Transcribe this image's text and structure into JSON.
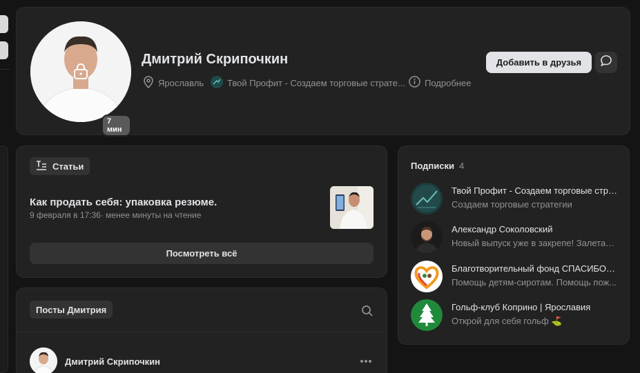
{
  "profile": {
    "name": "Дмитрий Скрипочкин",
    "online_badge": "7 мин",
    "city": "Ярославль",
    "work": "Твой Профит - Создаем торговые страте...",
    "more": "Подробнее",
    "add_friend": "Добавить в друзья"
  },
  "articles": {
    "chip": "Статьи",
    "title": "Как продать себя: упаковка резюме.",
    "meta": "9 февраля в 17:36· менее минуты на чтение",
    "see_all": "Посмотреть всё"
  },
  "posts": {
    "chip": "Посты Дмитрия",
    "author": "Дмитрий Скрипочкин"
  },
  "subscriptions": {
    "title": "Подписки",
    "count": "4",
    "items": [
      {
        "name": "Твой Профит - Создаем торговые стра...",
        "desc": "Создаем торговые стратегии"
      },
      {
        "name": "Александр Соколовский",
        "desc": "Новый выпуск уже в закрепе! Залетай..."
      },
      {
        "name": "Благотворительный фонд СПАСИБО | ...",
        "desc": "Помощь детям-сиротам. Помощь пож..."
      },
      {
        "name": "Гольф-клуб Коприно | Ярославия",
        "desc": "Открой для себя гольф ⛳"
      }
    ]
  },
  "colors": {
    "background": "#141414",
    "card": "#222222",
    "primary_button": "#e1e3e6",
    "secondary_text": "#939393"
  },
  "icons": [
    "lock-icon",
    "location-icon",
    "info-icon",
    "message-icon",
    "articles-icon",
    "search-icon",
    "more-icon"
  ]
}
